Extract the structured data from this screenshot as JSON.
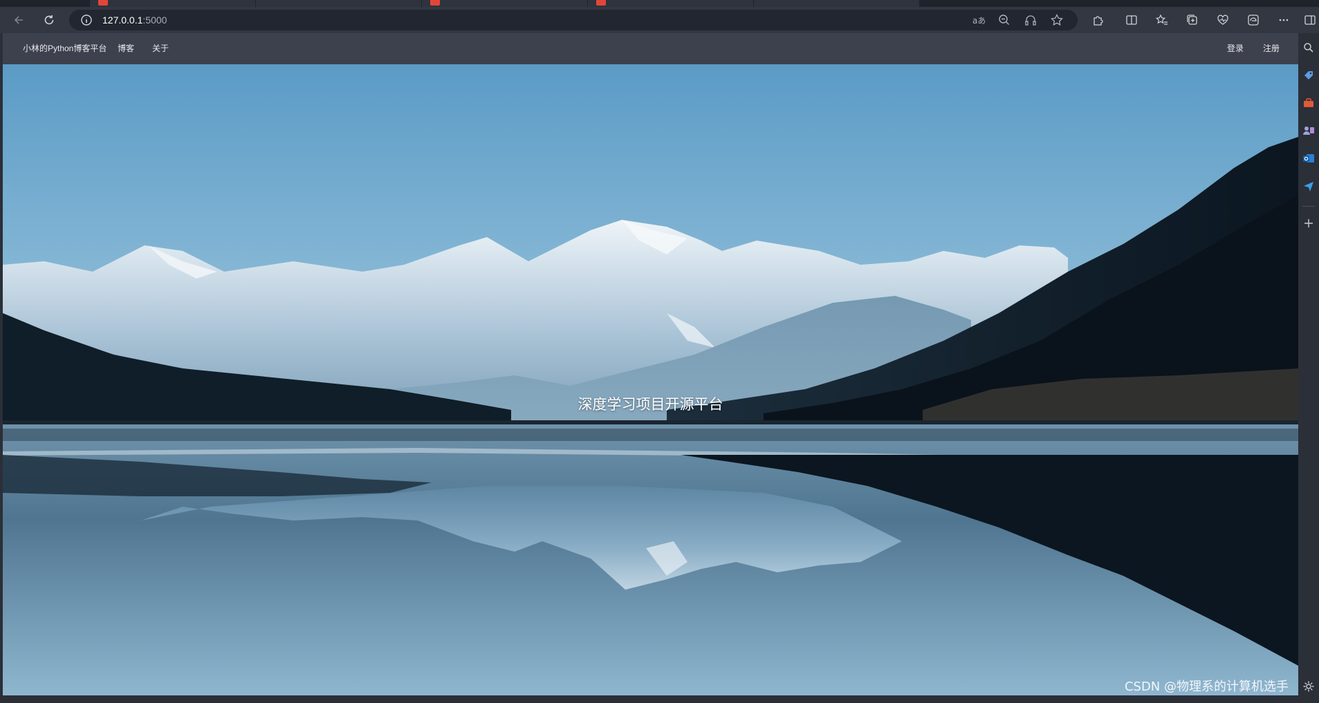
{
  "browser": {
    "url_host": "127.0.0.1",
    "url_port": ":5000"
  },
  "navbar": {
    "brand": "小林的Python博客平台",
    "blog_link": "博客",
    "about_link": "关于",
    "login_link": "登录",
    "register_link": "注册"
  },
  "hero": {
    "title": "深度学习项目开源平台"
  },
  "watermark": "CSDN @物理系的计算机选手"
}
